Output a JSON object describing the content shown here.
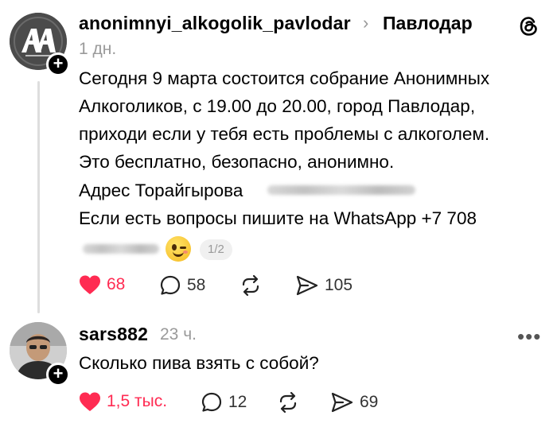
{
  "post": {
    "username": "anonimnyi_alkogolik_pavlodar",
    "location_chevron": "›",
    "location": "Павлодар",
    "time": "1 дн.",
    "avatar_icon": "aa-logo-icon",
    "lines": [
      "Сегодня 9 марта состоится собрание Анонимных",
      "Алкоголиков, с 19.00 до 20.00, город Павлодар,",
      "приходи если у тебя есть проблемы с алкоголем.",
      "Это бесплатно, безопасно, анонимно.",
      "Адрес Торайгырова",
      "Если есть вопросы пишите на WhatsApp +7 708"
    ],
    "pager": "1/2",
    "actions": {
      "likes": "68",
      "comments": "58",
      "reposts": "",
      "shares": "105"
    }
  },
  "reply": {
    "username": "sars882",
    "time": "23 ч.",
    "text": "Сколько пива взять с собой?",
    "actions": {
      "likes": "1,5 тыс.",
      "comments": "12",
      "reposts": "",
      "shares": "69"
    }
  },
  "colors": {
    "like_red": "#ff2b52",
    "secondary_text": "#9a9a9a"
  }
}
